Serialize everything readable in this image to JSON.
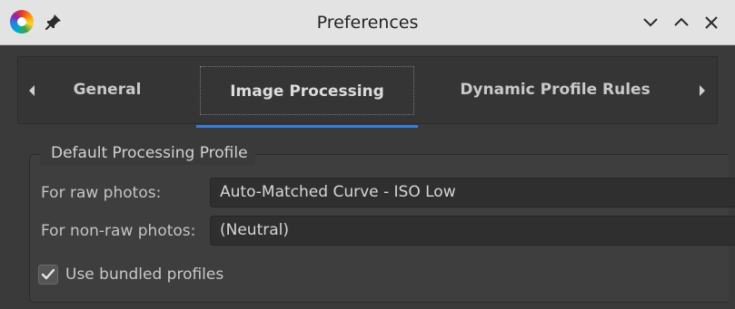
{
  "window": {
    "title": "Preferences",
    "app_icon": "color-wheel-icon",
    "pin_icon": "pin-icon",
    "controls": [
      "minimize-icon",
      "maximize-icon",
      "close-icon"
    ]
  },
  "tabs": {
    "items": [
      {
        "label": "General"
      },
      {
        "label": "Image Processing"
      },
      {
        "label": "Dynamic Profile Rules"
      }
    ],
    "active": "Image Processing",
    "accent_color": "#3b7cd8"
  },
  "group": {
    "title": "Default Processing Profile",
    "raw_label": "For raw photos:",
    "raw_value": "Auto-Matched Curve - ISO Low",
    "nonraw_label": "For non-raw photos:",
    "nonraw_value": "(Neutral)",
    "checkbox_label": "Use bundled profiles",
    "checkbox_checked": true
  }
}
